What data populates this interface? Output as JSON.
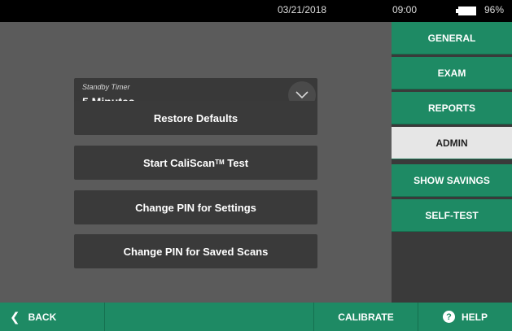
{
  "status": {
    "date": "03/21/2018",
    "time": "09:00",
    "battery": "96%"
  },
  "standby": {
    "label": "Standby Timer",
    "value": "5 Minutes"
  },
  "buttons": {
    "restore": "Restore Defaults",
    "start_prefix": "Start CaliScan",
    "start_tm": "TM",
    "start_suffix": " Test",
    "pin_settings": "Change PIN for Settings",
    "pin_scans": "Change PIN for Saved Scans"
  },
  "tabs": [
    "GENERAL",
    "EXAM",
    "REPORTS",
    "ADMIN",
    "SHOW SAVINGS",
    "SELF-TEST"
  ],
  "active_tab": "ADMIN",
  "footer": {
    "back": "BACK",
    "calibrate": "CALIBRATE",
    "help": "HELP",
    "help_glyph": "?"
  },
  "colors": {
    "accent": "#1e8a64",
    "panel": "#3a3a3a",
    "background": "#5b5b5b",
    "active_tab": "#e6e6e6"
  },
  "icons": {
    "dropdown": "chevron-down-icon",
    "back": "chevron-left-icon",
    "help": "help-circle-icon",
    "battery": "battery-icon"
  }
}
